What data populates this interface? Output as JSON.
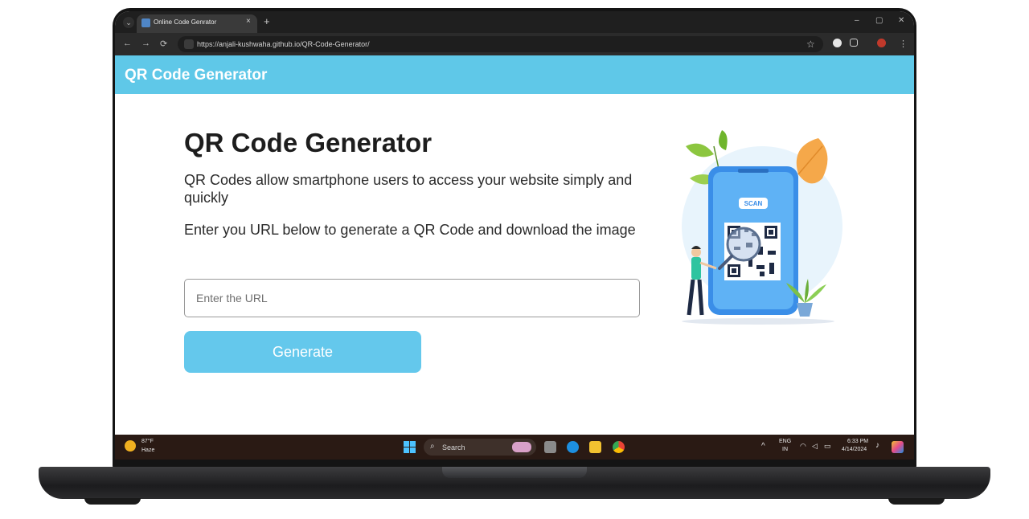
{
  "browser": {
    "tab_title": "Online Code Genrator",
    "tab_close": "×",
    "new_tab": "+",
    "url": "https://anjali-kushwaha.github.io/QR-Code-Generator/",
    "window_controls": {
      "minimize": "–",
      "maximize": "▢",
      "close": "✕"
    },
    "nav": {
      "back": "←",
      "forward": "→",
      "reload": "⟳"
    }
  },
  "header": {
    "title": "QR Code Generator"
  },
  "main": {
    "heading": "QR Code Generator",
    "description_1": "QR Codes allow smartphone users to access your website simply and quickly",
    "description_2": "Enter you URL below to generate a QR Code and download the image",
    "url_input_placeholder": "Enter the URL",
    "generate_label": "Generate",
    "illustration_scan_text": "SCAN"
  },
  "taskbar": {
    "weather_temp": "87°F",
    "weather_condition": "Haze",
    "search_placeholder": "Search",
    "lang_top": "ENG",
    "lang_bottom": "IN",
    "time": "6:33 PM",
    "date": "4/14/2024",
    "overflow_arrow": "^"
  },
  "colors": {
    "header_bg": "#5fc8e8",
    "button_bg": "#64c8ec",
    "taskbar_bg": "#2a1a14"
  }
}
